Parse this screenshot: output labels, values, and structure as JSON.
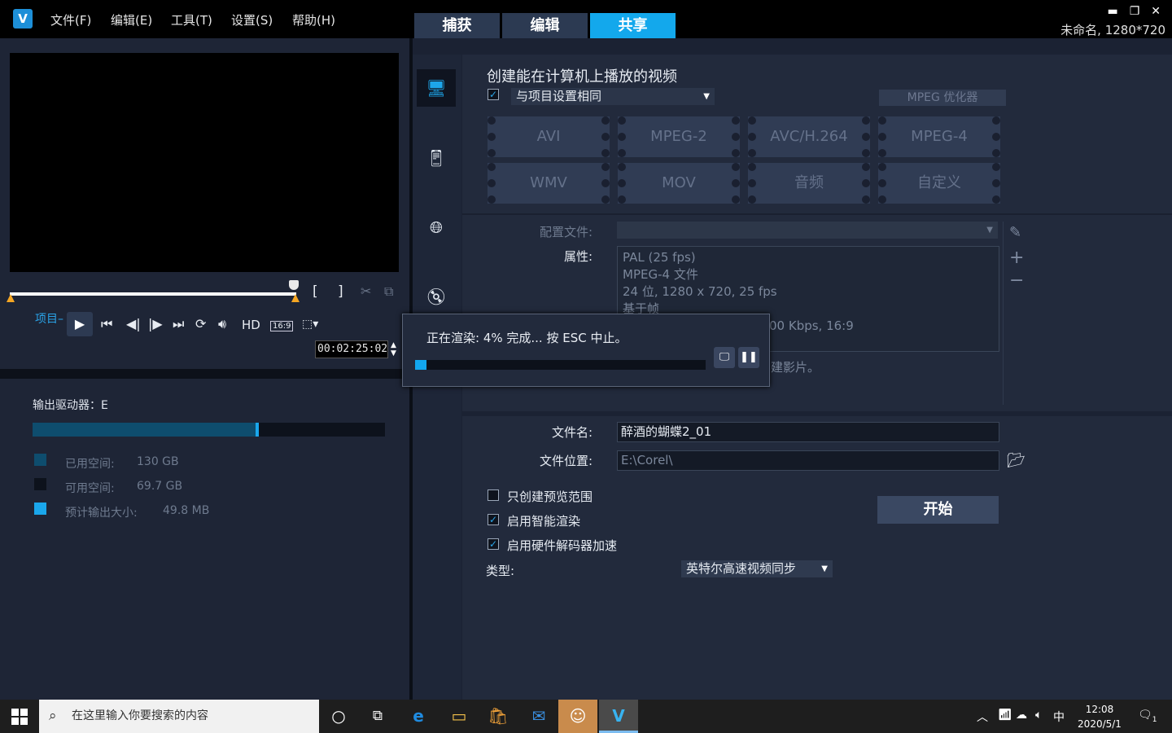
{
  "app": {
    "logo_text": "V",
    "menu": [
      "文件(F)",
      "编辑(E)",
      "工具(T)",
      "设置(S)",
      "帮助(H)"
    ],
    "tabs": [
      "捕获",
      "编辑",
      "共享"
    ],
    "active_tab": "共享",
    "project_info": "未命名, 1280*720",
    "accent_color": "#13a8ec"
  },
  "player": {
    "project_label": "项目",
    "hd_label": "HD",
    "aspect_label": "16:9",
    "timecode": "00:02:25:02"
  },
  "drive": {
    "label": "输出驱动器：E",
    "used_fraction": 0.633,
    "legend": [
      {
        "label": "已用空间:",
        "value": "130 GB",
        "color": "#0e4d6e"
      },
      {
        "label": "可用空间:",
        "value": "69.7 GB",
        "color": "#0d121c"
      },
      {
        "label": "预计输出大小:",
        "value": "49.8 MB",
        "color": "#1aa7ec"
      }
    ]
  },
  "share": {
    "title": "创建能在计算机上播放的视频",
    "same_as_project_checked": true,
    "preset": "与项目设置相同",
    "mpeg_optimizer": "MPEG 优化器",
    "formats": [
      "AVI",
      "MPEG-2",
      "AVC/H.264",
      "MPEG-4",
      "WMV",
      "MOV",
      "音频",
      "自定义"
    ],
    "profile_label": "配置文件:",
    "profile_value": "",
    "properties_label": "属性:",
    "properties": [
      "PAL (25 fps)",
      "MPEG-4 文件",
      "24 位, 1280 x 720, 25 fps",
      "基于帧",
      "00 Kbps, 16:9"
    ],
    "extra_note": "建影片。",
    "filename_label": "文件名:",
    "filename_value": "醉酒的蝴蝶2_01",
    "location_label": "文件位置:",
    "location_value": "E:\\Corel\\",
    "options": [
      {
        "label": "只创建预览范围",
        "checked": false
      },
      {
        "label": "启用智能渲染",
        "checked": true
      },
      {
        "label": "启用硬件解码器加速",
        "checked": true
      }
    ],
    "start_button": "开始",
    "type_label": "类型:",
    "type_value": "英特尔高速视频同步"
  },
  "render_dialog": {
    "message": "正在渲染: 4% 完成... 按 ESC 中止。",
    "progress": 0.04
  },
  "taskbar": {
    "search_placeholder": "在这里输入你要搜索的内容",
    "ime": "中",
    "time": "12:08",
    "date": "2020/5/1",
    "notification_count": "1"
  }
}
